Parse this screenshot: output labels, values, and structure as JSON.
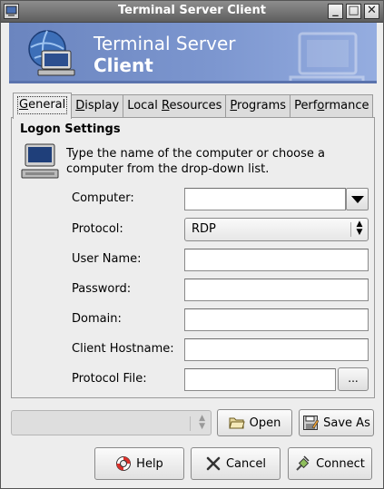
{
  "window": {
    "title": "Terminal Server Client",
    "menu_icon": "computer-icon",
    "minimize_glyph": "_",
    "maximize_glyph": "□",
    "close_glyph": "✕"
  },
  "banner": {
    "line1": "Terminal Server",
    "line2": "Client",
    "colors": {
      "start": "#6b85bf",
      "end": "#95ade0"
    }
  },
  "tabs": [
    {
      "label": "General",
      "underline": "G",
      "rest": "eneral",
      "active": true
    },
    {
      "label": "Display",
      "underline": "D",
      "rest": "isplay"
    },
    {
      "label": "Local Resources",
      "pre": "Local ",
      "underline": "R",
      "rest": "esources"
    },
    {
      "label": "Programs",
      "underline": "P",
      "rest": "rograms"
    },
    {
      "label": "Performance",
      "pre": "Perf",
      "underline": "o",
      "rest": "rmance"
    }
  ],
  "general": {
    "heading": "Logon Settings",
    "help_text": "Type the name of the computer or choose a computer from the drop-down list.",
    "fields": {
      "computer": {
        "label": "Computer:",
        "value": ""
      },
      "protocol": {
        "label": "Protocol:",
        "value": "RDP"
      },
      "username": {
        "label": "User Name:",
        "value": ""
      },
      "password": {
        "label": "Password:",
        "value": ""
      },
      "domain": {
        "label": "Domain:",
        "value": ""
      },
      "client_hostname": {
        "label": "Client Hostname:",
        "value": ""
      },
      "protocol_file": {
        "label": "Protocol File:",
        "value": "",
        "browse_label": "..."
      }
    }
  },
  "profile": {
    "value": ""
  },
  "buttons": {
    "open": "Open",
    "save_as": "Save As",
    "help": "Help",
    "cancel": "Cancel",
    "connect": "Connect"
  }
}
